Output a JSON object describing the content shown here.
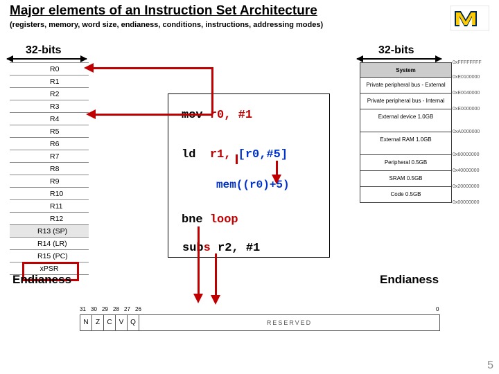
{
  "title": "Major elements of an Instruction Set Architecture",
  "subtitle": "(registers, memory, word size, endianess, conditions, instructions, addressing modes)",
  "bits_left": "32-bits",
  "bits_right": "32-bits",
  "registers": [
    "R0",
    "R1",
    "R2",
    "R3",
    "R4",
    "R5",
    "R6",
    "R7",
    "R8",
    "R9",
    "R10",
    "R11",
    "R12",
    "R13 (SP)",
    "R14 (LR)",
    "R15 (PC)",
    "xPSR"
  ],
  "memmap": [
    {
      "label": "System",
      "addr": "0xFFFFFFFF",
      "cls": "sys"
    },
    {
      "label": "Private peripheral bus - External",
      "addr": "0xE0100000",
      "cls": ""
    },
    {
      "label": "Private peripheral bus - Internal",
      "addr": "0xE0040000",
      "cls": ""
    },
    {
      "label": "External device   1.0GB",
      "addr": "0xE0000000",
      "cls": "sz"
    },
    {
      "label": "External RAM   1.0GB",
      "addr": "0xA0000000",
      "cls": "sz"
    },
    {
      "label": "Peripheral   0.5GB",
      "addr": "0x60000000",
      "cls": ""
    },
    {
      "label": "SRAM   0.5GB",
      "addr": "0x40000000",
      "cls": ""
    },
    {
      "label": "Code   0.5GB",
      "addr": "0x20000000",
      "cls": ""
    }
  ],
  "mem_last_addr": "0x00000000",
  "code": {
    "l1a": "mov ",
    "l1b": "r0, #1",
    "l2a": "ld",
    "l2b": "r1, ",
    "l2c": "[r0,#5]",
    "l3": "mem((r0)+5)",
    "l4a": "bne ",
    "l4b": "loop",
    "l5a": "sub",
    "l5b": "s",
    "l5c": " r2, #1"
  },
  "endianess_l": "Endianess",
  "endianess_r": "Endianess",
  "psr": {
    "bits": [
      "31",
      "30",
      "29",
      "28",
      "27",
      "26",
      "0"
    ],
    "flags": [
      "N",
      "Z",
      "C",
      "V",
      "Q"
    ],
    "reserved": "RESERVED"
  },
  "pagenum": "5"
}
